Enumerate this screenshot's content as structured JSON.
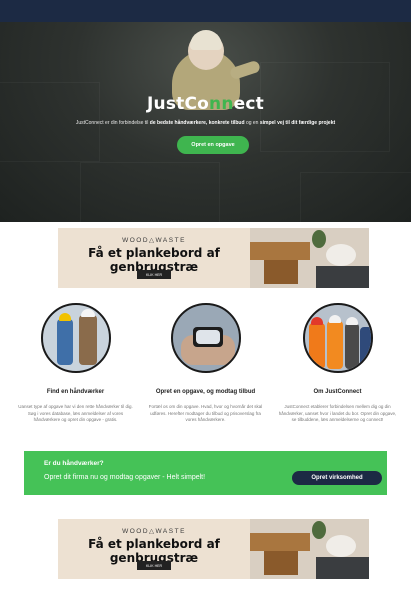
{
  "hero": {
    "logo_part1": "JustCo",
    "logo_accent": "nn",
    "logo_part2": "ect",
    "tagline_pre": "JustConnect er din forbindelse til",
    "tagline_bold1": "de bedste håndværkere, konkrete tilbud",
    "tagline_mid": "og en",
    "tagline_bold2": "simpel vej til dit færdige projekt",
    "cta_label": "Opret en opgave"
  },
  "ads": [
    {
      "brand": "WOOD△WASTE",
      "headline": "Få et plankebord af genbrugstræ",
      "cta": "KLIK HER"
    },
    {
      "brand": "WOOD△WASTE",
      "headline": "Få et plankebord af genbrugstræ",
      "cta": "KLIK HER"
    }
  ],
  "features": [
    {
      "title": "Find en håndværker",
      "text": "Uanset type af opgave har vi den rette håndværker til dig. Søg i vores database, læs anmeldelser af vores håndværkere og opret din opgave - gratis."
    },
    {
      "title": "Opret en opgave, og modtag tilbud",
      "text": "Fortæl os om din opgave. Hvad, hvor og hvornår det skal udføres. Herefter modtager du tilbud og prisoverslag fra vores håndværkere."
    },
    {
      "title": "Om JustConnect",
      "text": "JustConnect etablerer forbindelsen mellem dig og din håndværker, uanset hvor i landet du bor. Opret din opgave, se tilbuddene, læs anmeldelserne og connect!"
    }
  ],
  "banner": {
    "question": "Er du håndværker?",
    "subtitle": "Opret dit firma nu og modtag opgaver - Helt simpelt!",
    "button": "Opret virksomhed"
  },
  "colors": {
    "navy": "#1c2a44",
    "green": "#45c257",
    "accent_green": "#3fb54f"
  }
}
